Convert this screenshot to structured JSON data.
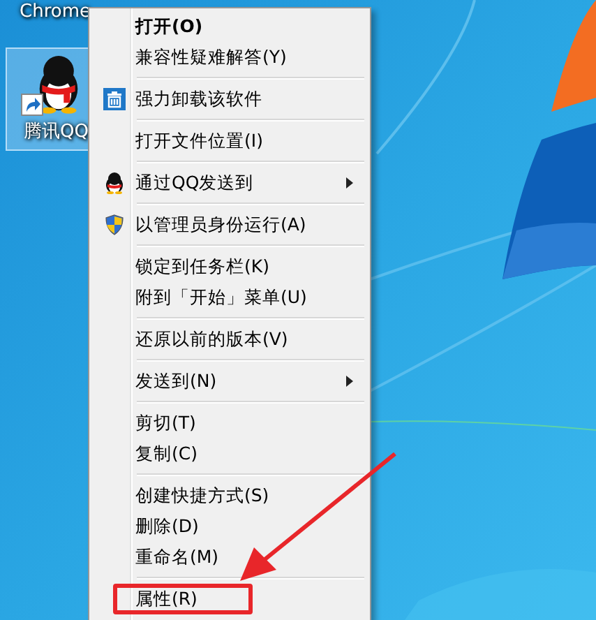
{
  "desktop_icons": [
    {
      "label": "Chrome",
      "kind": "label-only",
      "selected": false
    },
    {
      "label": "腾讯QQ",
      "kind": "qq",
      "selected": true
    }
  ],
  "context_menu": {
    "items": [
      {
        "kind": "item",
        "label": "打开(O)",
        "default": true,
        "submenu": false,
        "highlighted": false
      },
      {
        "kind": "item",
        "label": "兼容性疑难解答(Y)",
        "default": false,
        "submenu": false,
        "highlighted": false
      },
      {
        "kind": "separator"
      },
      {
        "kind": "item",
        "label": "强力卸载该软件",
        "default": false,
        "submenu": false,
        "highlighted": false
      },
      {
        "kind": "separator"
      },
      {
        "kind": "item",
        "label": "打开文件位置(I)",
        "default": false,
        "submenu": false,
        "highlighted": false
      },
      {
        "kind": "separator"
      },
      {
        "kind": "item",
        "label": "通过QQ发送到",
        "default": false,
        "submenu": true,
        "highlighted": false
      },
      {
        "kind": "separator"
      },
      {
        "kind": "item",
        "label": "以管理员身份运行(A)",
        "default": false,
        "submenu": false,
        "highlighted": false
      },
      {
        "kind": "separator"
      },
      {
        "kind": "item",
        "label": "锁定到任务栏(K)",
        "default": false,
        "submenu": false,
        "highlighted": false
      },
      {
        "kind": "item",
        "label": "附到「开始」菜单(U)",
        "default": false,
        "submenu": false,
        "highlighted": false
      },
      {
        "kind": "separator"
      },
      {
        "kind": "item",
        "label": "还原以前的版本(V)",
        "default": false,
        "submenu": false,
        "highlighted": false
      },
      {
        "kind": "separator"
      },
      {
        "kind": "item",
        "label": "发送到(N)",
        "default": false,
        "submenu": true,
        "highlighted": false
      },
      {
        "kind": "separator"
      },
      {
        "kind": "item",
        "label": "剪切(T)",
        "default": false,
        "submenu": false,
        "highlighted": false
      },
      {
        "kind": "item",
        "label": "复制(C)",
        "default": false,
        "submenu": false,
        "highlighted": false
      },
      {
        "kind": "separator"
      },
      {
        "kind": "item",
        "label": "创建快捷方式(S)",
        "default": false,
        "submenu": false,
        "highlighted": false
      },
      {
        "kind": "item",
        "label": "删除(D)",
        "default": false,
        "submenu": false,
        "highlighted": false
      },
      {
        "kind": "item",
        "label": "重命名(M)",
        "default": false,
        "submenu": false,
        "highlighted": false
      },
      {
        "kind": "separator"
      },
      {
        "kind": "item",
        "label": "属性(R)",
        "default": false,
        "submenu": false,
        "highlighted": true
      }
    ]
  }
}
